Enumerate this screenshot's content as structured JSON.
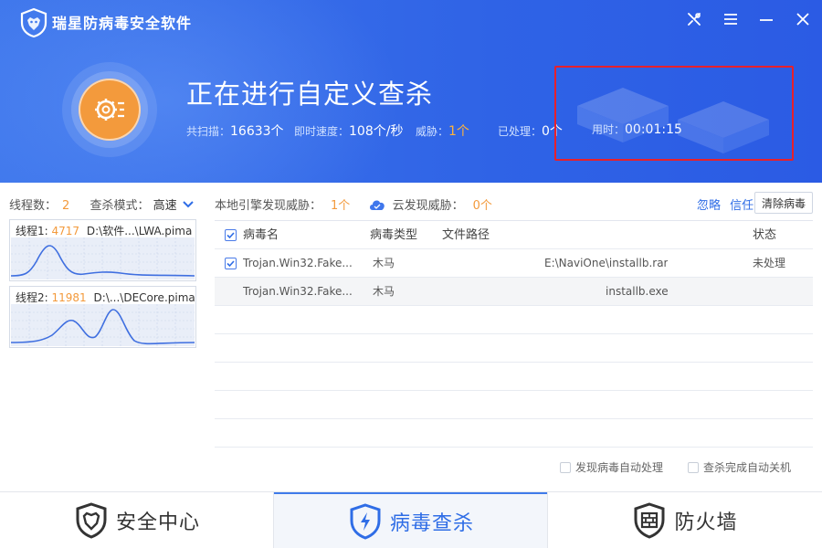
{
  "app": {
    "title": "瑞星防病毒安全软件"
  },
  "window_controls": [
    "tools-icon",
    "menu-icon",
    "minimize-icon",
    "close-icon"
  ],
  "scan": {
    "title": "正在进行自定义查杀",
    "stats": {
      "scanned_label": "共扫描：",
      "scanned_value": "16633个",
      "speed_label": "即时速度：",
      "speed_value": "108个/秒",
      "threat_label": "威胁：",
      "threat_value": "1个",
      "processed_label": "已处理：",
      "processed_value": "0个",
      "time_label": "用时：",
      "time_value": "00:01:15"
    }
  },
  "threads": {
    "count_label": "线程数：",
    "count_value": "2",
    "mode_label": "查杀模式：",
    "mode_value": "高速",
    "items": [
      {
        "label": "线程1:",
        "id": "4717",
        "path": "D:\\软件...\\LWA.pima"
      },
      {
        "label": "线程2:",
        "id": "11981",
        "path": "D:\\...\\DECore.pima"
      }
    ]
  },
  "threat_summary": {
    "local_label": "本地引擎发现威胁：",
    "local_value": "1个",
    "cloud_label": "云发现威胁：",
    "cloud_value": "0个"
  },
  "actions": {
    "ignore": "忽略",
    "trust": "信任",
    "clear": "清除病毒"
  },
  "table": {
    "headers": {
      "name": "病毒名",
      "type": "病毒类型",
      "path": "文件路径",
      "status": "状态"
    },
    "rows": [
      {
        "checked": true,
        "name": "Trojan.Win32.Fake...",
        "type": "木马",
        "path": "E:\\NaviOne\\installb.rar",
        "status": "未处理"
      },
      {
        "checked": false,
        "name": "Trojan.Win32.Fake...",
        "type": "木马",
        "path": "installb.exe",
        "status": ""
      }
    ]
  },
  "options": {
    "auto_handle": "发现病毒自动处理",
    "auto_shutdown": "查杀完成自动关机"
  },
  "nav": [
    {
      "label": "安全中心",
      "icon": "security-center-icon",
      "active": false
    },
    {
      "label": "病毒查杀",
      "icon": "virus-scan-icon",
      "active": true
    },
    {
      "label": "防火墙",
      "icon": "firewall-icon",
      "active": false
    }
  ],
  "colors": {
    "header_blue": "#3a6fea",
    "accent_orange": "#f39a3c",
    "link_blue": "#2f6de6",
    "annotation_red": "#e8202a"
  }
}
